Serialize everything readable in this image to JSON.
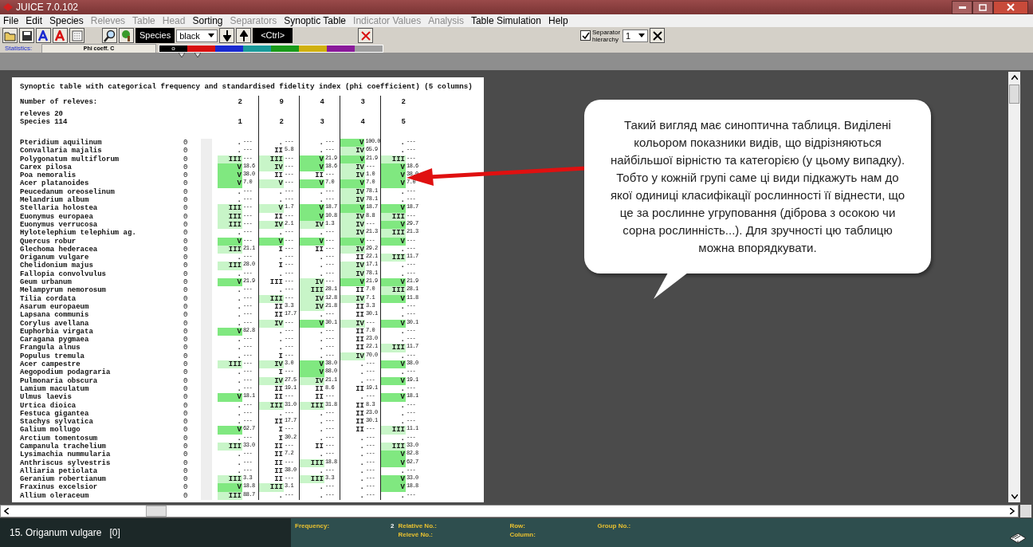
{
  "window": {
    "title": "JUICE 7.0.102"
  },
  "menu": [
    {
      "label": "File",
      "disabled": false
    },
    {
      "label": "Edit",
      "disabled": false
    },
    {
      "label": "Species",
      "disabled": false
    },
    {
      "label": "Releves",
      "disabled": true
    },
    {
      "label": "Table",
      "disabled": true
    },
    {
      "label": "Head",
      "disabled": true
    },
    {
      "label": "Sorting",
      "disabled": false
    },
    {
      "label": "Separators",
      "disabled": true
    },
    {
      "label": "Synoptic Table",
      "disabled": false
    },
    {
      "label": "Indicator Values",
      "disabled": true
    },
    {
      "label": "Analysis",
      "disabled": true
    },
    {
      "label": "Table Simulation",
      "disabled": false
    },
    {
      "label": "Help",
      "disabled": false
    }
  ],
  "toolbar": {
    "species_label": "Species",
    "color_select": "black",
    "ctrl_label": "<Ctrl>",
    "statistics_label": "Statistics:",
    "statistics_value": "Phi coeff. C",
    "separator_label": "Separator hierarchy",
    "separator_checked": true,
    "hierarchy_select": "1"
  },
  "palette": {
    "selection_mark": "o",
    "swatches": [
      {
        "color": "#000000",
        "selected": true
      },
      {
        "color": "#d81010",
        "selected": false
      },
      {
        "color": "#1a2ad0",
        "selected": false
      },
      {
        "color": "#1a9a9a",
        "selected": false
      },
      {
        "color": "#1a9a1a",
        "selected": false
      },
      {
        "color": "#d0b010",
        "selected": false
      },
      {
        "color": "#8a1a9a",
        "selected": false
      },
      {
        "color": "#a0a0a0",
        "selected": false
      }
    ]
  },
  "table": {
    "title": "Synoptic table with categorical frequency and standardised fidelity index (phi coefficient) (5 columns)",
    "releves_label": "Number of releves:",
    "releve_counts": [
      "2",
      "9",
      "4",
      "3",
      "2"
    ],
    "info_lines": [
      "releves 20",
      "Species 114"
    ],
    "column_numbers": [
      "1",
      "2",
      "3",
      "4",
      "5"
    ],
    "rows": [
      {
        "name": "Pteridium aquilinum",
        "value": "0",
        "cells": [
          {
            "frequency": ".",
            "fidelity": "---"
          },
          {
            "frequency": ".",
            "fidelity": "---"
          },
          {
            "frequency": ".",
            "fidelity": "---"
          },
          {
            "frequency": "V",
            "fidelity": "100.0",
            "color": "#80e880"
          },
          {
            "frequency": ".",
            "fidelity": "---"
          }
        ]
      },
      {
        "name": "Convallaria majalis",
        "value": "0",
        "cells": [
          {
            "frequency": ".",
            "fidelity": "---"
          },
          {
            "frequency": "II",
            "fidelity": "5.8"
          },
          {
            "frequency": ".",
            "fidelity": "---"
          },
          {
            "frequency": "IV",
            "fidelity": "65.9",
            "color": "#c8f5c8"
          },
          {
            "frequency": ".",
            "fidelity": "---"
          }
        ]
      },
      {
        "name": "Polygonatum multiflorum",
        "value": "0",
        "cells": [
          {
            "frequency": "III",
            "fidelity": "---",
            "color": "#c8f5c8"
          },
          {
            "frequency": "III",
            "fidelity": "---",
            "color": "#c8f5c8"
          },
          {
            "frequency": "V",
            "fidelity": "21.9",
            "color": "#80e880"
          },
          {
            "frequency": "V",
            "fidelity": "21.9",
            "color": "#80e880"
          },
          {
            "frequency": "III",
            "fidelity": "---",
            "color": "#c8f5c8"
          }
        ]
      },
      {
        "name": "Carex pilosa",
        "value": "0",
        "cells": [
          {
            "frequency": "V",
            "fidelity": "18.6",
            "color": "#80e880"
          },
          {
            "frequency": "IV",
            "fidelity": "---",
            "color": "#c8f5c8"
          },
          {
            "frequency": "V",
            "fidelity": "18.6",
            "color": "#80e880"
          },
          {
            "frequency": "IV",
            "fidelity": "---",
            "color": "#c8f5c8"
          },
          {
            "frequency": "V",
            "fidelity": "18.6",
            "color": "#80e880"
          }
        ]
      },
      {
        "name": "Poa nemoralis",
        "value": "0",
        "cells": [
          {
            "frequency": "V",
            "fidelity": "38.0",
            "color": "#80e880"
          },
          {
            "frequency": "II",
            "fidelity": "---"
          },
          {
            "frequency": "II",
            "fidelity": "---"
          },
          {
            "frequency": "IV",
            "fidelity": "1.0",
            "color": "#c8f5c8"
          },
          {
            "frequency": "V",
            "fidelity": "38.0",
            "color": "#80e880"
          }
        ]
      },
      {
        "name": "Acer platanoides",
        "value": "0",
        "cells": [
          {
            "frequency": "V",
            "fidelity": "7.0",
            "color": "#80e880"
          },
          {
            "frequency": "V",
            "fidelity": "---",
            "color": "#c8f5c8"
          },
          {
            "frequency": "V",
            "fidelity": "7.0",
            "color": "#80e880"
          },
          {
            "frequency": "V",
            "fidelity": "7.0",
            "color": "#80e880"
          },
          {
            "frequency": "V",
            "fidelity": "7.0",
            "color": "#80e880"
          }
        ]
      },
      {
        "name": "Peucedanum oreoselinum",
        "value": "0",
        "cells": [
          {
            "frequency": ".",
            "fidelity": "---"
          },
          {
            "frequency": ".",
            "fidelity": "---"
          },
          {
            "frequency": ".",
            "fidelity": "---"
          },
          {
            "frequency": "IV",
            "fidelity": "78.1",
            "color": "#c8f5c8"
          },
          {
            "frequency": ".",
            "fidelity": "---"
          }
        ]
      },
      {
        "name": "Melandrium album",
        "value": "0",
        "cells": [
          {
            "frequency": ".",
            "fidelity": "---"
          },
          {
            "frequency": ".",
            "fidelity": "---"
          },
          {
            "frequency": ".",
            "fidelity": "---"
          },
          {
            "frequency": "IV",
            "fidelity": "78.1",
            "color": "#c8f5c8"
          },
          {
            "frequency": ".",
            "fidelity": "---"
          }
        ]
      },
      {
        "name": "Stellaria holostea",
        "value": "0",
        "cells": [
          {
            "frequency": "III",
            "fidelity": "---",
            "color": "#c8f5c8"
          },
          {
            "frequency": "V",
            "fidelity": "1.7",
            "color": "#c8f5c8"
          },
          {
            "frequency": "V",
            "fidelity": "18.7",
            "color": "#80e880"
          },
          {
            "frequency": "V",
            "fidelity": "18.7",
            "color": "#80e880"
          },
          {
            "frequency": "V",
            "fidelity": "18.7",
            "color": "#80e880"
          }
        ]
      },
      {
        "name": "Euonymus europaea",
        "value": "0",
        "cells": [
          {
            "frequency": "III",
            "fidelity": "---",
            "color": "#c8f5c8"
          },
          {
            "frequency": "II",
            "fidelity": "---"
          },
          {
            "frequency": "V",
            "fidelity": "10.8",
            "color": "#80e880"
          },
          {
            "frequency": "IV",
            "fidelity": "8.8",
            "color": "#c8f5c8"
          },
          {
            "frequency": "III",
            "fidelity": "---",
            "color": "#c8f5c8"
          }
        ]
      },
      {
        "name": "Euonymus verrucosa",
        "value": "0",
        "cells": [
          {
            "frequency": "III",
            "fidelity": "---",
            "color": "#c8f5c8"
          },
          {
            "frequency": "IV",
            "fidelity": "2.1",
            "color": "#c8f5c8"
          },
          {
            "frequency": "IV",
            "fidelity": "1.3",
            "color": "#c8f5c8"
          },
          {
            "frequency": "IV",
            "fidelity": "---",
            "color": "#c8f5c8"
          },
          {
            "frequency": "V",
            "fidelity": "29.7",
            "color": "#80e880"
          }
        ]
      },
      {
        "name": "Hylotelephium telephium ag.",
        "value": "0",
        "cells": [
          {
            "frequency": ".",
            "fidelity": "---"
          },
          {
            "frequency": ".",
            "fidelity": "---"
          },
          {
            "frequency": ".",
            "fidelity": "---"
          },
          {
            "frequency": "IV",
            "fidelity": "21.3",
            "color": "#c8f5c8"
          },
          {
            "frequency": "III",
            "fidelity": "21.3",
            "color": "#c8f5c8"
          }
        ]
      },
      {
        "name": "Quercus robur",
        "value": "0",
        "cells": [
          {
            "frequency": "V",
            "fidelity": "---",
            "color": "#80e880"
          },
          {
            "frequency": "V",
            "fidelity": "---",
            "color": "#80e880"
          },
          {
            "frequency": "V",
            "fidelity": "---",
            "color": "#80e880"
          },
          {
            "frequency": "V",
            "fidelity": "---",
            "color": "#80e880"
          },
          {
            "frequency": "V",
            "fidelity": "---",
            "color": "#80e880"
          }
        ]
      },
      {
        "name": "Glechoma hederacea",
        "value": "0",
        "cells": [
          {
            "frequency": "III",
            "fidelity": "21.1",
            "color": "#c8f5c8"
          },
          {
            "frequency": "I",
            "fidelity": "---"
          },
          {
            "frequency": "II",
            "fidelity": "---"
          },
          {
            "frequency": "IV",
            "fidelity": "29.2",
            "color": "#c8f5c8"
          },
          {
            "frequency": ".",
            "fidelity": "---"
          }
        ]
      },
      {
        "name": "Origanum vulgare",
        "value": "0",
        "cells": [
          {
            "frequency": ".",
            "fidelity": "---"
          },
          {
            "frequency": ".",
            "fidelity": "---"
          },
          {
            "frequency": ".",
            "fidelity": "---"
          },
          {
            "frequency": "II",
            "fidelity": "22.1"
          },
          {
            "frequency": "III",
            "fidelity": "11.7",
            "color": "#c8f5c8"
          }
        ]
      },
      {
        "name": "Chelidonium majus",
        "value": "0",
        "cells": [
          {
            "frequency": "III",
            "fidelity": "28.0",
            "color": "#c8f5c8"
          },
          {
            "frequency": "I",
            "fidelity": "---"
          },
          {
            "frequency": ".",
            "fidelity": "---"
          },
          {
            "frequency": "IV",
            "fidelity": "17.1",
            "color": "#c8f5c8"
          },
          {
            "frequency": ".",
            "fidelity": "---"
          }
        ]
      },
      {
        "name": "Fallopia convolvulus",
        "value": "0",
        "cells": [
          {
            "frequency": ".",
            "fidelity": "---"
          },
          {
            "frequency": ".",
            "fidelity": "---"
          },
          {
            "frequency": ".",
            "fidelity": "---"
          },
          {
            "frequency": "IV",
            "fidelity": "78.1",
            "color": "#c8f5c8"
          },
          {
            "frequency": ".",
            "fidelity": "---"
          }
        ]
      },
      {
        "name": "Geum urbanum",
        "value": "0",
        "cells": [
          {
            "frequency": "V",
            "fidelity": "21.9",
            "color": "#80e880"
          },
          {
            "frequency": "III",
            "fidelity": "---"
          },
          {
            "frequency": "IV",
            "fidelity": "---",
            "color": "#c8f5c8"
          },
          {
            "frequency": "V",
            "fidelity": "21.9",
            "color": "#80e880"
          },
          {
            "frequency": "V",
            "fidelity": "21.9",
            "color": "#80e880"
          }
        ]
      },
      {
        "name": "Melampyrum nemorosum",
        "value": "0",
        "cells": [
          {
            "frequency": ".",
            "fidelity": "---"
          },
          {
            "frequency": ".",
            "fidelity": "---"
          },
          {
            "frequency": "III",
            "fidelity": "28.1",
            "color": "#c8f5c8"
          },
          {
            "frequency": "II",
            "fidelity": "7.0"
          },
          {
            "frequency": "III",
            "fidelity": "28.1",
            "color": "#c8f5c8"
          }
        ]
      },
      {
        "name": "Tilia cordata",
        "value": "0",
        "cells": [
          {
            "frequency": ".",
            "fidelity": "---"
          },
          {
            "frequency": "III",
            "fidelity": "---",
            "color": "#c8f5c8"
          },
          {
            "frequency": "IV",
            "fidelity": "12.8",
            "color": "#c8f5c8"
          },
          {
            "frequency": "IV",
            "fidelity": "7.1",
            "color": "#c8f5c8"
          },
          {
            "frequency": "V",
            "fidelity": "11.8",
            "color": "#80e880"
          }
        ]
      },
      {
        "name": "Asarum europaeum",
        "value": "0",
        "cells": [
          {
            "frequency": ".",
            "fidelity": "---"
          },
          {
            "frequency": "II",
            "fidelity": "3.3"
          },
          {
            "frequency": "IV",
            "fidelity": "21.8",
            "color": "#c8f5c8"
          },
          {
            "frequency": "II",
            "fidelity": "3.3"
          },
          {
            "frequency": ".",
            "fidelity": "---"
          }
        ]
      },
      {
        "name": "Lapsana communis",
        "value": "0",
        "cells": [
          {
            "frequency": ".",
            "fidelity": "---"
          },
          {
            "frequency": "II",
            "fidelity": "17.7"
          },
          {
            "frequency": ".",
            "fidelity": "---"
          },
          {
            "frequency": "II",
            "fidelity": "30.1"
          },
          {
            "frequency": ".",
            "fidelity": "---"
          }
        ]
      },
      {
        "name": "Corylus avellana",
        "value": "0",
        "cells": [
          {
            "frequency": ".",
            "fidelity": "---"
          },
          {
            "frequency": "IV",
            "fidelity": "---",
            "color": "#c8f5c8"
          },
          {
            "frequency": "V",
            "fidelity": "30.1",
            "color": "#80e880"
          },
          {
            "frequency": "IV",
            "fidelity": "---",
            "color": "#c8f5c8"
          },
          {
            "frequency": "V",
            "fidelity": "30.1",
            "color": "#80e880"
          }
        ]
      },
      {
        "name": "Euphorbia virgata",
        "value": "0",
        "cells": [
          {
            "frequency": "V",
            "fidelity": "82.8",
            "color": "#80e880"
          },
          {
            "frequency": ".",
            "fidelity": "---"
          },
          {
            "frequency": ".",
            "fidelity": "---"
          },
          {
            "frequency": "II",
            "fidelity": "7.0"
          },
          {
            "frequency": ".",
            "fidelity": "---"
          }
        ]
      },
      {
        "name": "Caragana pygmaea",
        "value": "0",
        "cells": [
          {
            "frequency": ".",
            "fidelity": "---"
          },
          {
            "frequency": ".",
            "fidelity": "---"
          },
          {
            "frequency": ".",
            "fidelity": "---"
          },
          {
            "frequency": "II",
            "fidelity": "23.0"
          },
          {
            "frequency": ".",
            "fidelity": "---"
          }
        ]
      },
      {
        "name": "Frangula alnus",
        "value": "0",
        "cells": [
          {
            "frequency": ".",
            "fidelity": "---"
          },
          {
            "frequency": ".",
            "fidelity": "---"
          },
          {
            "frequency": ".",
            "fidelity": "---"
          },
          {
            "frequency": "II",
            "fidelity": "22.1"
          },
          {
            "frequency": "III",
            "fidelity": "11.7",
            "color": "#c8f5c8"
          }
        ]
      },
      {
        "name": "Populus tremula",
        "value": "0",
        "cells": [
          {
            "frequency": ".",
            "fidelity": "---"
          },
          {
            "frequency": "I",
            "fidelity": "---"
          },
          {
            "frequency": ".",
            "fidelity": "---"
          },
          {
            "frequency": "IV",
            "fidelity": "70.0",
            "color": "#c8f5c8"
          },
          {
            "frequency": ".",
            "fidelity": "---"
          }
        ]
      },
      {
        "name": "Acer campestre",
        "value": "0",
        "cells": [
          {
            "frequency": "III",
            "fidelity": "---",
            "color": "#c8f5c8"
          },
          {
            "frequency": "IV",
            "fidelity": "3.0",
            "color": "#c8f5c8"
          },
          {
            "frequency": "V",
            "fidelity": "38.0",
            "color": "#80e880"
          },
          {
            "frequency": ".",
            "fidelity": "---"
          },
          {
            "frequency": "V",
            "fidelity": "38.0",
            "color": "#80e880"
          }
        ]
      },
      {
        "name": "Aegopodium podagraria",
        "value": "0",
        "cells": [
          {
            "frequency": ".",
            "fidelity": "---"
          },
          {
            "frequency": "I",
            "fidelity": "---"
          },
          {
            "frequency": "V",
            "fidelity": "88.0",
            "color": "#80e880"
          },
          {
            "frequency": ".",
            "fidelity": "---"
          },
          {
            "frequency": ".",
            "fidelity": "---"
          }
        ]
      },
      {
        "name": "Pulmonaria obscura",
        "value": "0",
        "cells": [
          {
            "frequency": ".",
            "fidelity": "---"
          },
          {
            "frequency": "IV",
            "fidelity": "27.5",
            "color": "#c8f5c8"
          },
          {
            "frequency": "IV",
            "fidelity": "21.1",
            "color": "#c8f5c8"
          },
          {
            "frequency": ".",
            "fidelity": "---"
          },
          {
            "frequency": "V",
            "fidelity": "19.1",
            "color": "#80e880"
          }
        ]
      },
      {
        "name": "Lamium maculatum",
        "value": "0",
        "cells": [
          {
            "frequency": ".",
            "fidelity": "---"
          },
          {
            "frequency": "II",
            "fidelity": "19.1"
          },
          {
            "frequency": "II",
            "fidelity": "8.6"
          },
          {
            "frequency": "II",
            "fidelity": "19.1"
          },
          {
            "frequency": ".",
            "fidelity": "---"
          }
        ]
      },
      {
        "name": "Ulmus laevis",
        "value": "0",
        "cells": [
          {
            "frequency": "V",
            "fidelity": "18.1",
            "color": "#80e880"
          },
          {
            "frequency": "II",
            "fidelity": "---"
          },
          {
            "frequency": "II",
            "fidelity": "---"
          },
          {
            "frequency": ".",
            "fidelity": "---"
          },
          {
            "frequency": "V",
            "fidelity": "18.1",
            "color": "#80e880"
          }
        ]
      },
      {
        "name": "Urtica dioica",
        "value": "0",
        "cells": [
          {
            "frequency": ".",
            "fidelity": "---"
          },
          {
            "frequency": "III",
            "fidelity": "31.0",
            "color": "#c8f5c8"
          },
          {
            "frequency": "III",
            "fidelity": "31.8",
            "color": "#c8f5c8"
          },
          {
            "frequency": "II",
            "fidelity": "8.3"
          },
          {
            "frequency": ".",
            "fidelity": "---"
          }
        ]
      },
      {
        "name": "Festuca gigantea",
        "value": "0",
        "cells": [
          {
            "frequency": ".",
            "fidelity": "---"
          },
          {
            "frequency": ".",
            "fidelity": "---"
          },
          {
            "frequency": ".",
            "fidelity": "---"
          },
          {
            "frequency": "II",
            "fidelity": "23.0"
          },
          {
            "frequency": ".",
            "fidelity": "---"
          }
        ]
      },
      {
        "name": "Stachys sylvatica",
        "value": "0",
        "cells": [
          {
            "frequency": ".",
            "fidelity": "---"
          },
          {
            "frequency": "II",
            "fidelity": "17.7"
          },
          {
            "frequency": ".",
            "fidelity": "---"
          },
          {
            "frequency": "II",
            "fidelity": "30.1"
          },
          {
            "frequency": ".",
            "fidelity": "---"
          }
        ]
      },
      {
        "name": "Galium mollugo",
        "value": "0",
        "cells": [
          {
            "frequency": "V",
            "fidelity": "62.7",
            "color": "#80e880"
          },
          {
            "frequency": "I",
            "fidelity": "---"
          },
          {
            "frequency": ".",
            "fidelity": "---"
          },
          {
            "frequency": "II",
            "fidelity": "---"
          },
          {
            "frequency": "III",
            "fidelity": "11.1",
            "color": "#c8f5c8"
          }
        ]
      },
      {
        "name": "Arctium tomentosum",
        "value": "0",
        "cells": [
          {
            "frequency": ".",
            "fidelity": "---"
          },
          {
            "frequency": "I",
            "fidelity": "30.2"
          },
          {
            "frequency": ".",
            "fidelity": "---"
          },
          {
            "frequency": ".",
            "fidelity": "---"
          },
          {
            "frequency": ".",
            "fidelity": "---"
          }
        ]
      },
      {
        "name": "Campanula trachelium",
        "value": "0",
        "cells": [
          {
            "frequency": "III",
            "fidelity": "33.0",
            "color": "#c8f5c8"
          },
          {
            "frequency": "II",
            "fidelity": "---"
          },
          {
            "frequency": "II",
            "fidelity": "---"
          },
          {
            "frequency": ".",
            "fidelity": "---"
          },
          {
            "frequency": "III",
            "fidelity": "33.0",
            "color": "#c8f5c8"
          }
        ]
      },
      {
        "name": "Lysimachia nummularia",
        "value": "0",
        "cells": [
          {
            "frequency": ".",
            "fidelity": "---"
          },
          {
            "frequency": "II",
            "fidelity": "7.2"
          },
          {
            "frequency": ".",
            "fidelity": "---"
          },
          {
            "frequency": ".",
            "fidelity": "---"
          },
          {
            "frequency": "V",
            "fidelity": "82.8",
            "color": "#80e880"
          }
        ]
      },
      {
        "name": "Anthriscus sylvestris",
        "value": "0",
        "cells": [
          {
            "frequency": ".",
            "fidelity": "---"
          },
          {
            "frequency": "II",
            "fidelity": "---"
          },
          {
            "frequency": "III",
            "fidelity": "18.8",
            "color": "#c8f5c8"
          },
          {
            "frequency": ".",
            "fidelity": "---"
          },
          {
            "frequency": "V",
            "fidelity": "62.7",
            "color": "#80e880"
          }
        ]
      },
      {
        "name": "Alliaria petiolata",
        "value": "0",
        "cells": [
          {
            "frequency": ".",
            "fidelity": "---"
          },
          {
            "frequency": "II",
            "fidelity": "38.0"
          },
          {
            "frequency": ".",
            "fidelity": "---"
          },
          {
            "frequency": ".",
            "fidelity": "---"
          },
          {
            "frequency": ".",
            "fidelity": "---"
          }
        ]
      },
      {
        "name": "Geranium robertianum",
        "value": "0",
        "cells": [
          {
            "frequency": "III",
            "fidelity": "3.3",
            "color": "#c8f5c8"
          },
          {
            "frequency": "II",
            "fidelity": "---"
          },
          {
            "frequency": "III",
            "fidelity": "3.3",
            "color": "#c8f5c8"
          },
          {
            "frequency": ".",
            "fidelity": "---"
          },
          {
            "frequency": "V",
            "fidelity": "33.0",
            "color": "#80e880"
          }
        ]
      },
      {
        "name": "Fraxinus excelsior",
        "value": "0",
        "cells": [
          {
            "frequency": "V",
            "fidelity": "18.8",
            "color": "#80e880"
          },
          {
            "frequency": "III",
            "fidelity": "3.1",
            "color": "#c8f5c8"
          },
          {
            "frequency": ".",
            "fidelity": "---"
          },
          {
            "frequency": ".",
            "fidelity": "---"
          },
          {
            "frequency": "V",
            "fidelity": "18.8",
            "color": "#80e880"
          }
        ]
      },
      {
        "name": "Allium oleraceum",
        "value": "0",
        "cells": [
          {
            "frequency": "III",
            "fidelity": "88.7",
            "color": "#c8f5c8"
          },
          {
            "frequency": ".",
            "fidelity": "---"
          },
          {
            "frequency": ".",
            "fidelity": "---"
          },
          {
            "frequency": ".",
            "fidelity": "---"
          },
          {
            "frequency": ".",
            "fidelity": "---"
          }
        ]
      }
    ]
  },
  "callout": {
    "text": "Такий вигляд має синоптична таблиця. Виділені кольором показники видів, що відрізняються найбільшої вірністю та категорією (у цьому випадку). Тобто у кожній групі саме ці види підкажуть нам до якої одиниці класифікації рослинності її віднести, що це за рослинне угруповання (діброва з осокою чи сорна рослинність...). Для зручності цю таблицю можна впорядкувати."
  },
  "status_bar": {
    "species": "15. Origanum vulgare   [0]",
    "frequency_label": "Frequency:",
    "frequency_value": "2",
    "relative_label": "Relative No.:",
    "releve_label": "Relevé No.:",
    "row_label": "Row:",
    "column_label": "Column:",
    "group_label": "Group No.:"
  }
}
